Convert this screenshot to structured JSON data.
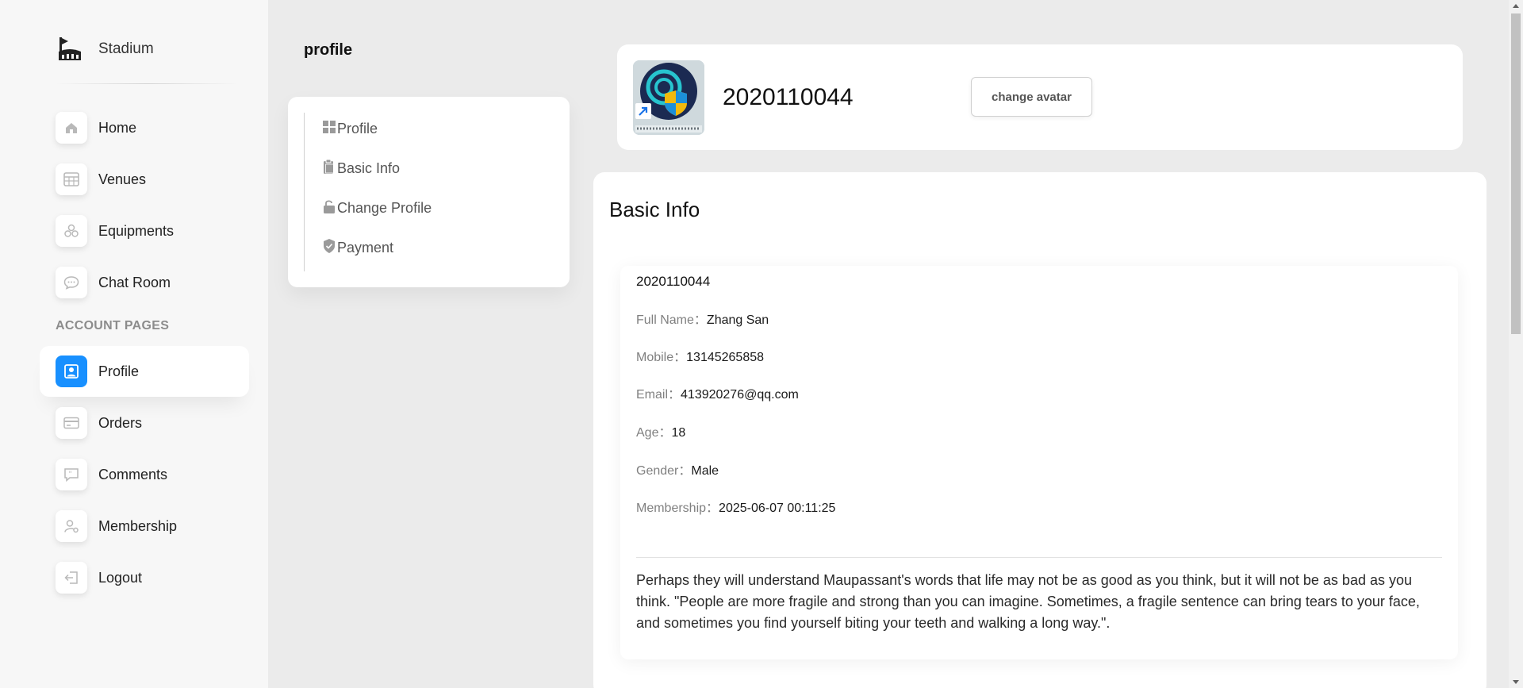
{
  "brand": {
    "name": "Stadium",
    "icon": "stadium-logo-icon"
  },
  "sidebar": {
    "items": [
      {
        "label": "Home",
        "icon": "home-icon"
      },
      {
        "label": "Venues",
        "icon": "table-icon"
      },
      {
        "label": "Equipments",
        "icon": "cubes-icon"
      },
      {
        "label": "Chat Room",
        "icon": "chat-icon"
      }
    ],
    "section_title": "ACCOUNT PAGES",
    "account_items": [
      {
        "label": "Profile",
        "icon": "profile-icon",
        "active": true
      },
      {
        "label": "Orders",
        "icon": "card-icon"
      },
      {
        "label": "Comments",
        "icon": "quote-icon"
      },
      {
        "label": "Membership",
        "icon": "user-settings-icon"
      },
      {
        "label": "Logout",
        "icon": "logout-icon"
      }
    ]
  },
  "page": {
    "title": "profile"
  },
  "submenu": {
    "items": [
      {
        "label": "Profile",
        "icon": "grid-icon"
      },
      {
        "label": "Basic Info",
        "icon": "clipboard-icon"
      },
      {
        "label": "Change Profile",
        "icon": "unlock-icon"
      },
      {
        "label": "Payment",
        "icon": "shield-check-icon"
      }
    ]
  },
  "header": {
    "username": "2020110044",
    "change_avatar_label": "change avatar"
  },
  "info": {
    "title": "Basic Info",
    "username": "2020110044",
    "fields": [
      {
        "key": "Full Name：",
        "value": "Zhang San"
      },
      {
        "key": "Mobile：",
        "value": "13145265858"
      },
      {
        "key": "Email：",
        "value": "413920276@qq.com"
      },
      {
        "key": "Age：",
        "value": "18"
      },
      {
        "key": "Gender：",
        "value": "Male"
      },
      {
        "key": "Membership：",
        "value": "2025-06-07 00:11:25"
      }
    ],
    "bio": "Perhaps they will understand Maupassant's words that life may not be as good as you think, but it will not be as bad as you think. \"People are more fragile and strong than you can imagine. Sometimes, a fragile sentence can bring tears to your face, and sometimes you find yourself biting your teeth and walking a long way.\"."
  },
  "colors": {
    "accent": "#1890ff",
    "background": "#ebebeb",
    "sidebar": "#f7f7f7"
  }
}
